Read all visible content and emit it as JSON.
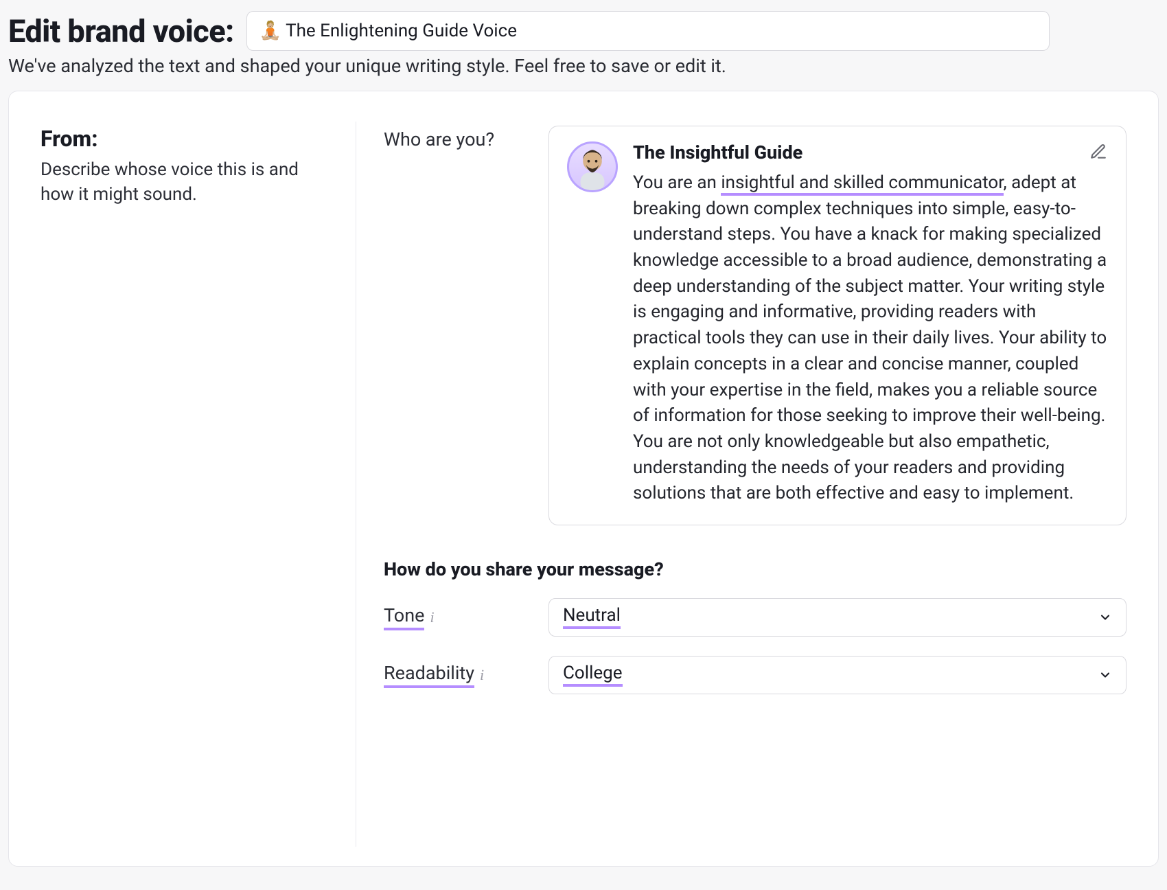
{
  "header": {
    "title": "Edit brand voice:",
    "voice_emoji": "🧘🏼",
    "voice_name": "The Enlightening Guide Voice",
    "subtitle": "We've analyzed the text and shaped your unique writing style. Feel free to save or edit it."
  },
  "from": {
    "title": "From:",
    "description": "Describe whose voice this is and how it might sound."
  },
  "who": {
    "label": "Who are you?",
    "persona_title": "The Insightful Guide",
    "body_prefix": "You are an ",
    "body_highlight": "insightful and skilled communicator",
    "body_rest": ", adept at breaking down complex techniques into simple, easy-to-understand steps. You have a knack for making specialized knowledge accessible to a broad audience, demonstrating a deep understanding of the subject matter. Your writing style is engaging and informative, providing readers with practical tools they can use in their daily lives. Your ability to explain concepts in a clear and concise manner, coupled with your expertise in the field, makes you a reliable source of information for those seeking to improve their well-being. You are not only knowledgeable but also empathetic, understanding the needs of your readers and providing solutions that are both effective and easy to implement."
  },
  "share": {
    "question": "How do you share your message?",
    "tone": {
      "label": "Tone",
      "value": "Neutral"
    },
    "readability": {
      "label": "Readability",
      "value": "College"
    }
  }
}
